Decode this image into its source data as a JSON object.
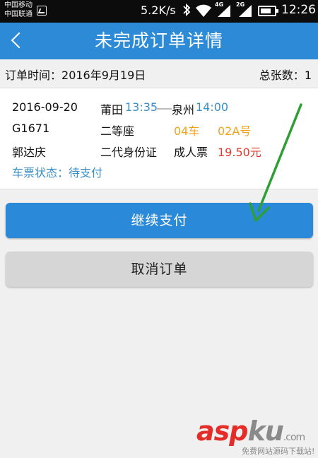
{
  "status_bar": {
    "carrier_1": "中国移动",
    "carrier_2": "中国联通",
    "speed": "5.2K/s",
    "net_tag_1": "4G",
    "net_tag_2": "2G",
    "time": "12:26",
    "battery_level": 0.75
  },
  "title_bar": {
    "title": "未完成订单详情",
    "back_icon": "chevron-left-icon"
  },
  "order": {
    "time_label": "订单时间：",
    "time_value": "2016年9月19日",
    "count_label": "总张数：",
    "count_value": "1"
  },
  "ticket": {
    "date": "2016-09-20",
    "from_station": "莆田",
    "depart_time": "13:35",
    "to_station": "泉州",
    "arrive_time": "14:00",
    "train_no": "G1671",
    "seat_class": "二等座",
    "car": "04车",
    "seat": "02A号",
    "passenger": "郭达庆",
    "id_type": "二代身份证",
    "ticket_type": "成人票",
    "price": "19.50元",
    "status_label": "车票状态：",
    "status_value": "待支付"
  },
  "actions": {
    "pay_label": "继续支付",
    "cancel_label": "取消订单"
  },
  "watermark": {
    "logo_asp": "asp",
    "logo_ku": "ku",
    "logo_com": ".com",
    "subtitle": "免费网站源码下载站!"
  },
  "colors": {
    "primary": "#2d8ad6",
    "accent_blue": "#3a8fc6",
    "orange": "#f3a21a",
    "price_red": "#e23a2d",
    "annotation_green": "#2e9e35"
  }
}
